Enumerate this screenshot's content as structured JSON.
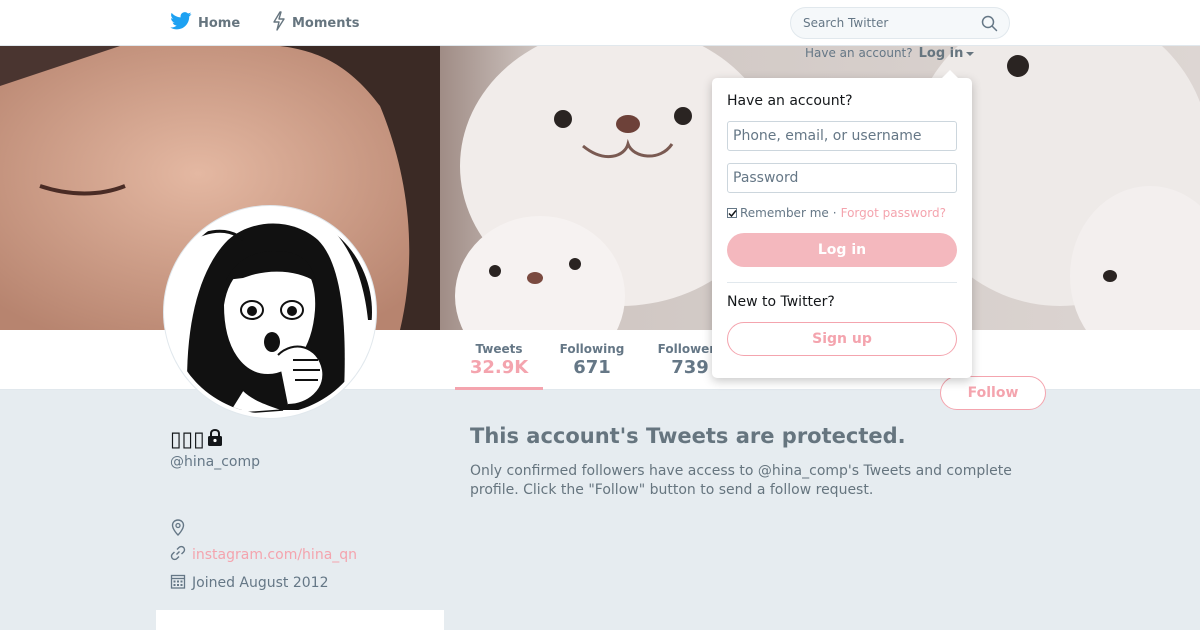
{
  "nav": {
    "home_label": "Home",
    "moments_label": "Moments",
    "search_placeholder": "Search Twitter"
  },
  "header": {
    "have_account_text": "Have an account?",
    "login_label": "Log in"
  },
  "profile": {
    "name": "▯▯▯",
    "handle": "@hina_comp",
    "url": "instagram.com/hina_qn",
    "joined": "Joined August 2012",
    "protected": true
  },
  "stats": [
    {
      "label": "Tweets",
      "value": "32.9K",
      "active": true
    },
    {
      "label": "Following",
      "value": "671",
      "active": false
    },
    {
      "label": "Followers",
      "value": "739",
      "active": false
    }
  ],
  "follow_button_label": "Follow",
  "protected_notice": {
    "title": "This account's Tweets are protected.",
    "body": "Only confirmed followers have access to @hina_comp's Tweets and complete profile. Click the \"Follow\" button to send a follow request."
  },
  "login_dropdown": {
    "heading": "Have an account?",
    "username_placeholder": "Phone, email, or username",
    "password_placeholder": "Password",
    "remember_label": "Remember me",
    "separator": "·",
    "forgot_label": "Forgot password?",
    "login_button": "Log in",
    "new_heading": "New to Twitter?",
    "signup_button": "Sign up"
  },
  "icons": {
    "home": "twitter-bird-icon",
    "moments": "lightning-icon",
    "search": "search-icon",
    "lock": "lock-icon",
    "location": "location-pin-icon",
    "link": "link-icon",
    "calendar": "calendar-icon",
    "caret": "caret-down-icon"
  },
  "colors": {
    "accent": "#f4a4ae",
    "twitter_blue": "#1da1f2",
    "background": "#e6ecf0",
    "muted_text": "#657786"
  }
}
